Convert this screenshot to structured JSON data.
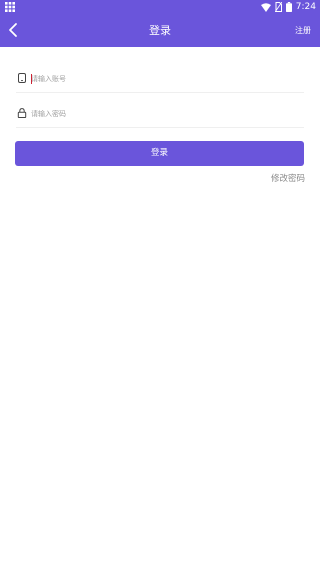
{
  "status_bar": {
    "time": "7:24",
    "icons": [
      "grid-icon",
      "wifi-icon",
      "no-sim-icon",
      "battery-icon"
    ]
  },
  "header": {
    "title": "登录",
    "register_label": "注册",
    "background_color": "#6a55db",
    "back_icon": "chevron-left-icon"
  },
  "form": {
    "account_placeholder": "请输入账号",
    "password_placeholder": "请输入密码",
    "account_icon": "phone-icon",
    "password_icon": "lock-icon"
  },
  "login_button": {
    "label": "登录"
  },
  "modify_password_label": "修改密码"
}
